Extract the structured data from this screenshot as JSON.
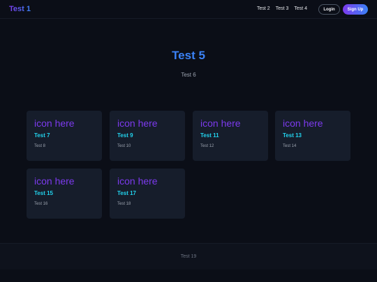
{
  "header": {
    "logo": "Test 1",
    "nav": [
      "Test 2",
      "Test 3",
      "Test 4"
    ],
    "login_label": "Login",
    "signup_label": "Sign Up"
  },
  "hero": {
    "title": "Test 5",
    "subtitle": "Test 6"
  },
  "features": [
    {
      "icon": "icon here",
      "title": "Test 7",
      "desc": "Test 8"
    },
    {
      "icon": "icon here",
      "title": "Test 9",
      "desc": "Test 10"
    },
    {
      "icon": "icon here",
      "title": "Test 11",
      "desc": "Test 12"
    },
    {
      "icon": "icon here",
      "title": "Test 13",
      "desc": "Test 14"
    },
    {
      "icon": "icon here",
      "title": "Test 15",
      "desc": "Test 16"
    },
    {
      "icon": "icon here",
      "title": "Test 17",
      "desc": "Test 18"
    }
  ],
  "footer": {
    "text": "Test 19"
  },
  "colors": {
    "background": "#0b0e17",
    "card": "#161d2b",
    "accent_purple": "#7c3aed",
    "accent_blue": "#3b82f6",
    "accent_cyan": "#22d3ee"
  }
}
